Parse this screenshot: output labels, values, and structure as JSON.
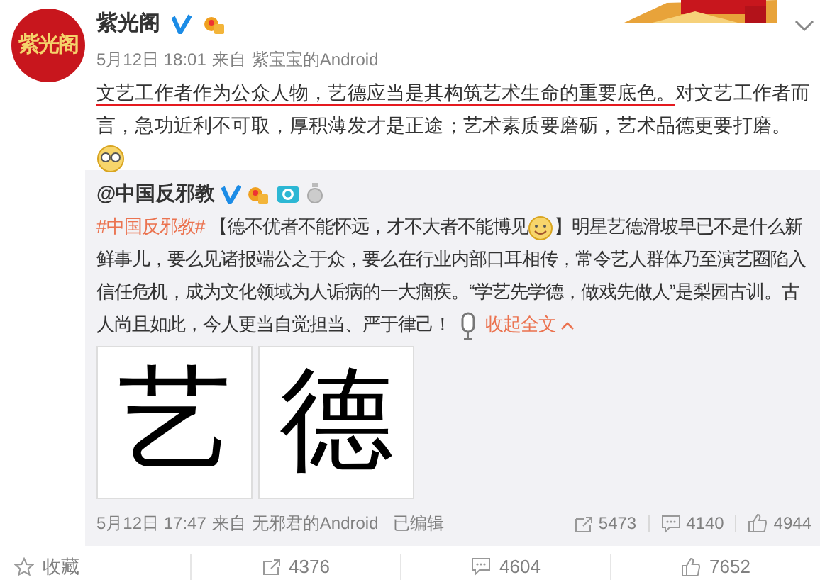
{
  "author": {
    "name": "紫光阁",
    "verified": true,
    "avatar_text": "紫光阁"
  },
  "meta": {
    "date": "5月12日 18:01",
    "source_prefix": "来自",
    "source": "紫宝宝的Android"
  },
  "body": [
    {
      "kind": "underlined",
      "text": "文艺工作者作为公众人物，艺德应当是其构筑艺术生命的重要底色。"
    },
    {
      "kind": "text",
      "text": "对文艺工作者而言，急功近利不可取，厚积薄发才是正途；艺术素质要磨砺，艺术品德更要打磨。"
    },
    {
      "kind": "emoji"
    }
  ],
  "repost": {
    "author": "@中国反邪教",
    "verified": true,
    "segments": [
      {
        "kind": "hashtag",
        "text": "#中国反邪教#"
      },
      {
        "kind": "text",
        "text": "【德不优者不能怀远，才不大者不能博见"
      },
      {
        "kind": "emoji"
      },
      {
        "kind": "text",
        "text": "】明星艺德滑坡早已不是什么新鲜事儿，要么见诸报端公之于众，要么在行业内部口耳相传，常令艺人群体乃至演艺圈陷入信任危机，成为文化领域为人诟病的一大痼疾。“学艺先学德，做戏先做人”是梨园古训。古人尚且如此，今人更当自觉担当、严于律己！"
      },
      {
        "kind": "voice"
      },
      {
        "kind": "link",
        "text": "收起全文"
      }
    ],
    "images": [
      {
        "char": "艺"
      },
      {
        "char": "德"
      }
    ],
    "meta": {
      "date": "5月12日 17:47",
      "source_prefix": "来自",
      "source": "无邪君的Android",
      "edited": "已编辑"
    },
    "stats": [
      {
        "kind": "repost",
        "count": "5473"
      },
      {
        "kind": "comment",
        "count": "4140"
      },
      {
        "kind": "like",
        "count": "4944"
      }
    ]
  },
  "actions": [
    {
      "kind": "favorite",
      "label": "收藏"
    },
    {
      "kind": "repost",
      "label": "4376"
    },
    {
      "kind": "comment",
      "label": "4604"
    },
    {
      "kind": "like",
      "label": "7652"
    }
  ]
}
